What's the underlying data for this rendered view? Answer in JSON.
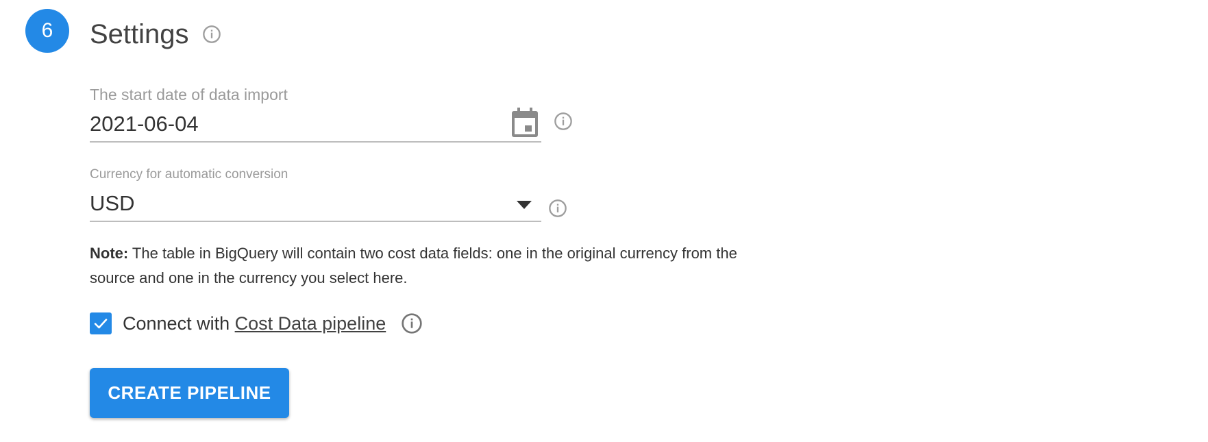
{
  "step": {
    "number": "6",
    "title": "Settings",
    "color": "#2389e6"
  },
  "date_field": {
    "label": "The start date of data import",
    "value": "2021-06-04",
    "icon": "calendar-icon"
  },
  "currency_field": {
    "label": "Currency for automatic conversion",
    "value": "USD",
    "icon": "dropdown-arrow-icon"
  },
  "note": {
    "prefix": "Note:",
    "text": " The table in BigQuery will contain two cost data fields: one in the original currency from the source and one in the currency you select here."
  },
  "connect": {
    "checked": true,
    "prefix": "Connect with ",
    "link_text": "Cost Data pipeline"
  },
  "actions": {
    "create_label": "CREATE PIPELINE"
  },
  "icons": {
    "info": "info-icon",
    "check": "check-icon"
  }
}
